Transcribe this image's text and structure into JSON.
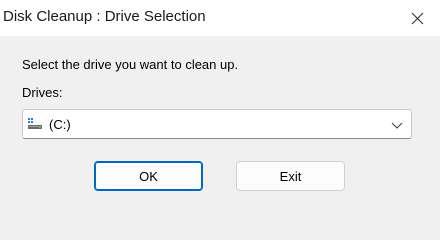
{
  "window": {
    "title": "Disk Cleanup : Drive Selection"
  },
  "dialog": {
    "prompt": "Select the drive you want to clean up.",
    "drives_label": "Drives:",
    "drive_select": {
      "selected": "(C:)",
      "icon": "drive-icon"
    },
    "ok_label": "OK",
    "exit_label": "Exit"
  },
  "colors": {
    "accent": "#0067c0",
    "background": "#f0f0f0",
    "titlebar": "#ffffff"
  }
}
